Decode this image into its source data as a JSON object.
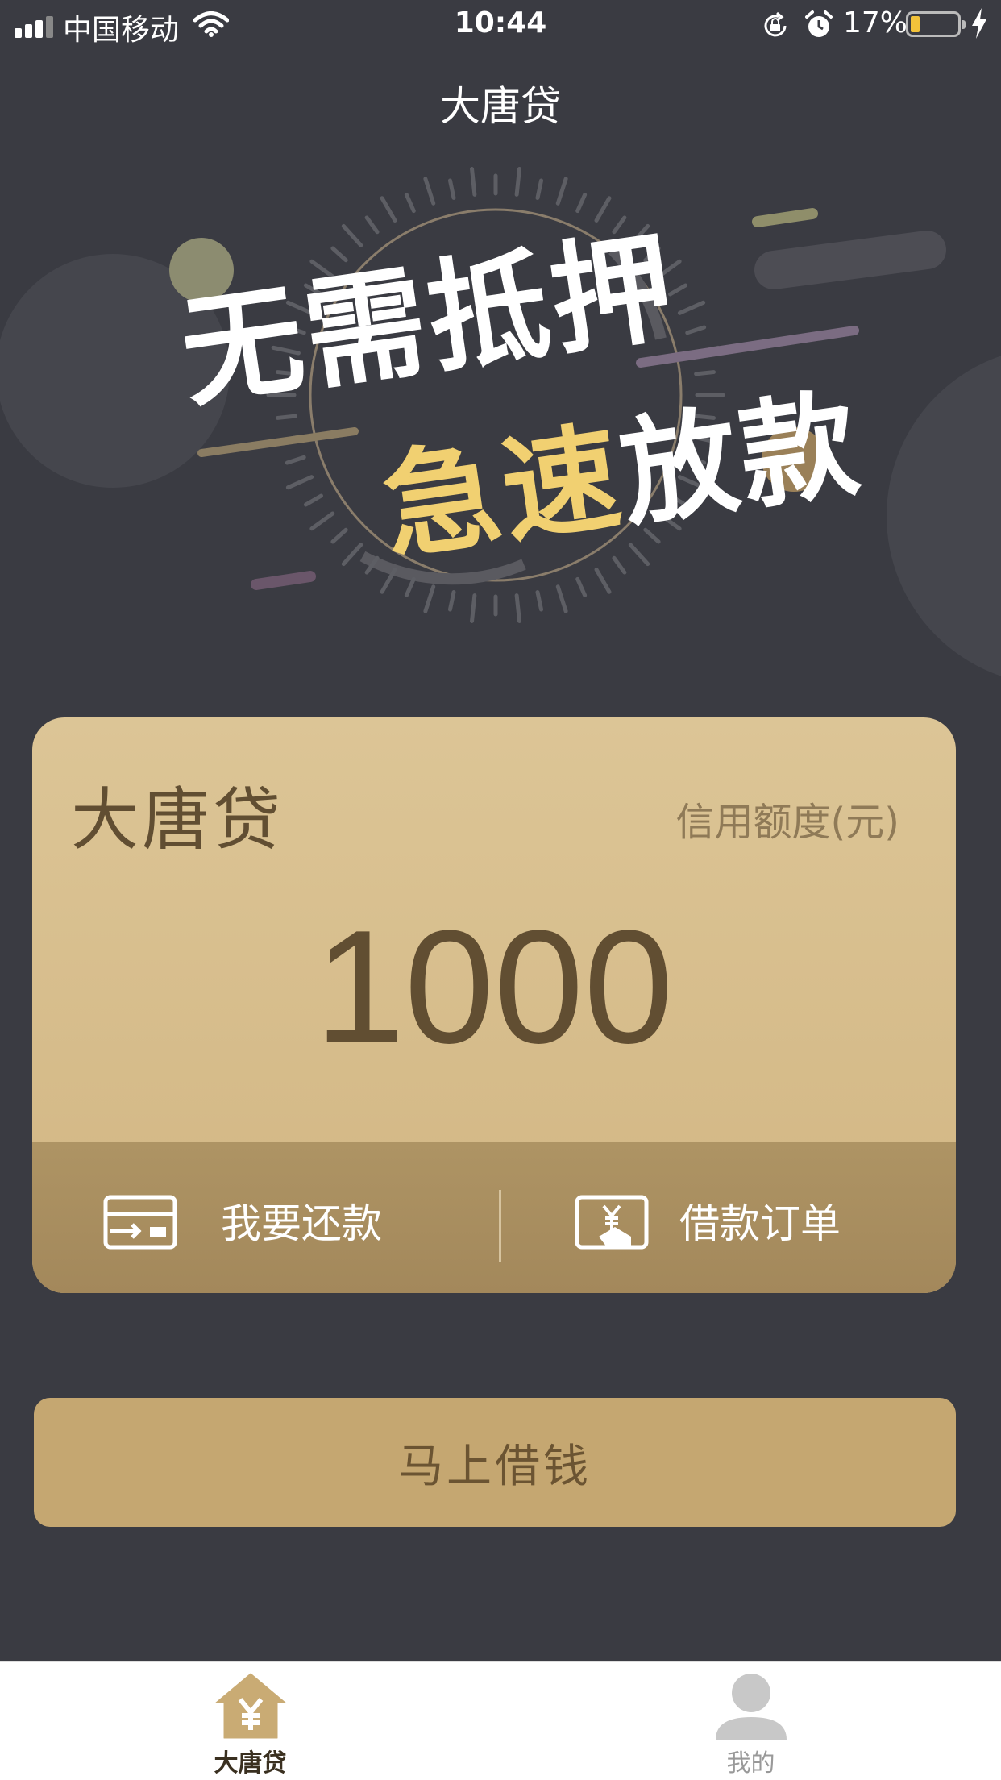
{
  "status_bar": {
    "carrier": "中国移动",
    "time": "10:44",
    "battery_percent": "17%",
    "battery_level": 0.17,
    "icons": [
      "signal-icon",
      "wifi-icon",
      "rotation-lock-icon",
      "alarm-icon",
      "battery-icon",
      "charging-icon"
    ]
  },
  "header": {
    "title": "大唐贷"
  },
  "hero": {
    "line1": "无需抵押",
    "line2_highlight": "急速",
    "line2_rest": "放款",
    "highlight_color": "#f1d071"
  },
  "credit_card": {
    "brand": "大唐贷",
    "limit_label": "信用额度(元)",
    "amount": "1000",
    "actions": [
      {
        "label": "我要还款",
        "icon": "card-repay-icon"
      },
      {
        "label": "借款订单",
        "icon": "order-yuan-icon"
      }
    ]
  },
  "borrow_button": {
    "label": "马上借钱"
  },
  "tab_bar": {
    "tabs": [
      {
        "label": "大唐贷",
        "icon": "house-yuan-icon",
        "active": true
      },
      {
        "label": "我的",
        "icon": "user-icon",
        "active": false
      }
    ]
  },
  "colors": {
    "background": "#3a3b42",
    "card_gold": "#dcc596",
    "action_bar": "#a3885b",
    "button_gold": "#c5a771",
    "brand_brown": "#614e32"
  }
}
